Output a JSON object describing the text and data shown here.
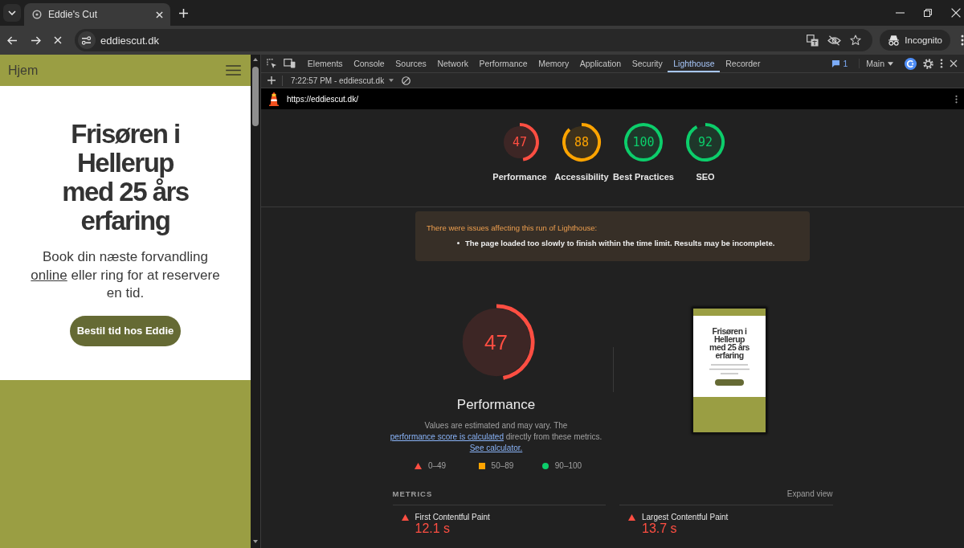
{
  "browser": {
    "tabs": [
      {
        "title": "Eddie's Cut",
        "selected": true
      }
    ],
    "address": "eddiescut.dk",
    "profile": "Incognito"
  },
  "website": {
    "nav_title": "Hjem",
    "heading": "Frisøren i Hellerup med 25 års erfaring",
    "intro": [
      {
        "kind": "text",
        "text": "Book din næste forvandling "
      },
      {
        "kind": "link",
        "text": "online"
      },
      {
        "kind": "text",
        "text": " eller ring for at reservere en tid."
      }
    ],
    "cta": "Bestil tid hos Eddie"
  },
  "devtools": {
    "panels": [
      {
        "label": "Elements",
        "selected": false
      },
      {
        "label": "Console",
        "selected": false
      },
      {
        "label": "Sources",
        "selected": false
      },
      {
        "label": "Network",
        "selected": false
      },
      {
        "label": "Performance",
        "selected": false
      },
      {
        "label": "Memory",
        "selected": false
      },
      {
        "label": "Application",
        "selected": false
      },
      {
        "label": "Security",
        "selected": false
      },
      {
        "label": "Lighthouse",
        "selected": true
      },
      {
        "label": "Recorder",
        "selected": false
      }
    ],
    "issues_count": "1",
    "context": "Main",
    "report": "7:22:57 PM - eddiescut.dk",
    "url": "https://eddiescut.dk/"
  },
  "lighthouse": {
    "categories": [
      {
        "name": "Performance",
        "score": "47",
        "level": 0.47,
        "color": "#ff4e42"
      },
      {
        "name": "Accessibility",
        "score": "88",
        "level": 0.88,
        "color": "#ffa400"
      },
      {
        "name": "Best Practices",
        "score": "100",
        "level": 1,
        "color": "#0cce6b"
      },
      {
        "name": "SEO",
        "score": "92",
        "level": 0.92,
        "color": "#0cce6b"
      }
    ],
    "warning": {
      "title": "There were issues affecting this run of Lighthouse:",
      "items": [
        "The page loaded too slowly to finish within the time limit. Results may be incomplete."
      ]
    },
    "performance": {
      "score": "47",
      "level": 0.47,
      "color": "#ff4e42",
      "title": "Performance",
      "description": [
        {
          "kind": "text",
          "text": "Values are estimated and may vary. The "
        },
        {
          "kind": "link",
          "text": "performance score is calculated"
        },
        {
          "kind": "text",
          "text": " directly from these metrics. "
        },
        {
          "kind": "link",
          "text": "See calculator."
        }
      ],
      "legend": [
        {
          "kind": "triangle",
          "label": "0–49",
          "color": "#ff4e42"
        },
        {
          "kind": "square",
          "label": "50–89",
          "color": "#ffa400"
        },
        {
          "kind": "circle",
          "label": "90–100",
          "color": "#0cce6b"
        }
      ],
      "screenshot": {
        "heading": "Frisøren i Hellerup med 25 års erfaring"
      }
    },
    "metrics": {
      "title": "METRICS",
      "toggle": "Expand view",
      "items": [
        {
          "name": "First Contentful Paint",
          "value": "12.1 s",
          "color": "#ff4e42"
        },
        {
          "name": "Largest Contentful Paint",
          "value": "13.7 s",
          "color": "#ff4e42"
        }
      ]
    }
  }
}
